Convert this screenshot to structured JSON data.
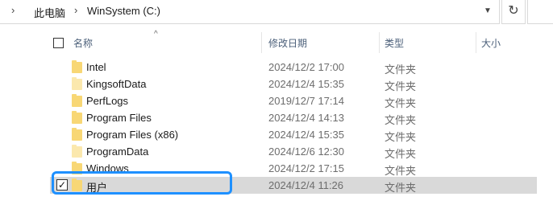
{
  "address": {
    "breadcrumbs": [
      "此电脑",
      "WinSystem (C:)"
    ],
    "separator": "›",
    "dropdown_icon": "chevron-down-icon",
    "refresh_icon": "refresh-icon",
    "refresh_glyph": "↻"
  },
  "header": {
    "columns": [
      "名称",
      "修改日期",
      "类型",
      "大小"
    ],
    "sort_glyph": "^"
  },
  "rows": [
    {
      "name": "Intel",
      "date": "2024/12/2 17:00",
      "type": "文件夹",
      "icon": "folder",
      "faded": false
    },
    {
      "name": "KingsoftData",
      "date": "2024/12/4 15:35",
      "type": "文件夹",
      "icon": "folder",
      "faded": true
    },
    {
      "name": "PerfLogs",
      "date": "2019/12/7 17:14",
      "type": "文件夹",
      "icon": "folder",
      "faded": false
    },
    {
      "name": "Program Files",
      "date": "2024/12/4 14:13",
      "type": "文件夹",
      "icon": "folder",
      "faded": false
    },
    {
      "name": "Program Files (x86)",
      "date": "2024/12/4 15:35",
      "type": "文件夹",
      "icon": "folder",
      "faded": false
    },
    {
      "name": "ProgramData",
      "date": "2024/12/6 12:30",
      "type": "文件夹",
      "icon": "folder",
      "faded": true
    },
    {
      "name": "Windows",
      "date": "2024/12/2 17:15",
      "type": "文件夹",
      "icon": "folder",
      "faded": false
    },
    {
      "name": "用户",
      "date": "2024/12/4 11:26",
      "type": "文件夹",
      "icon": "folder",
      "faded": false,
      "selected": true,
      "checked": true
    }
  ],
  "check_glyph": "✓",
  "colors": {
    "highlight": "#1e90ff",
    "selected_row": "#d9d9d9",
    "folder": "#f8d775"
  }
}
